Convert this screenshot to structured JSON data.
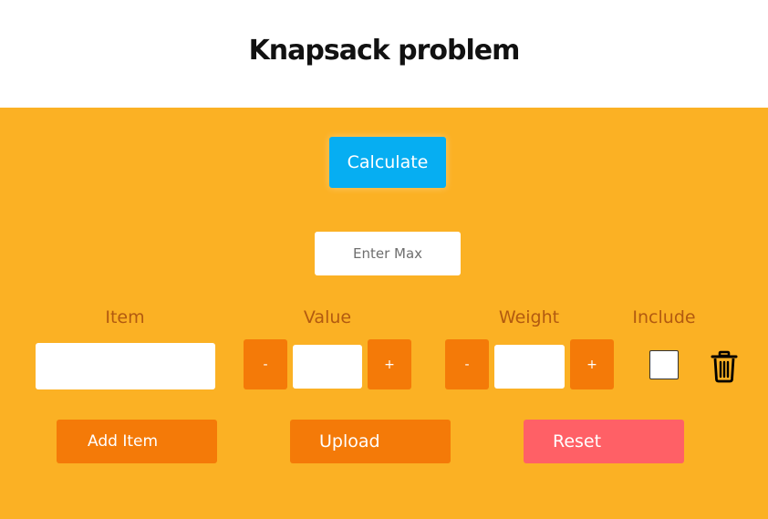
{
  "header": {
    "title": "Knapsack problem"
  },
  "controls": {
    "calculate_label": "Calculate",
    "max_placeholder": "Enter Max"
  },
  "columns": {
    "item": "Item",
    "value": "Value",
    "weight": "Weight",
    "include": "Include"
  },
  "item_row": {
    "item_value": "",
    "value_value": "",
    "weight_value": "",
    "include_checked": false,
    "minus_label": "-",
    "plus_label": "+",
    "delete_icon": "trash-icon"
  },
  "actions": {
    "add_item": "Add Item",
    "upload": "Upload",
    "reset": "Reset"
  },
  "colors": {
    "panel_background": "#fbb124",
    "calculate_button": "#06aef2",
    "action_button": "#f47a08",
    "reset_button": "#ff6066",
    "column_label": "#b25a10"
  }
}
